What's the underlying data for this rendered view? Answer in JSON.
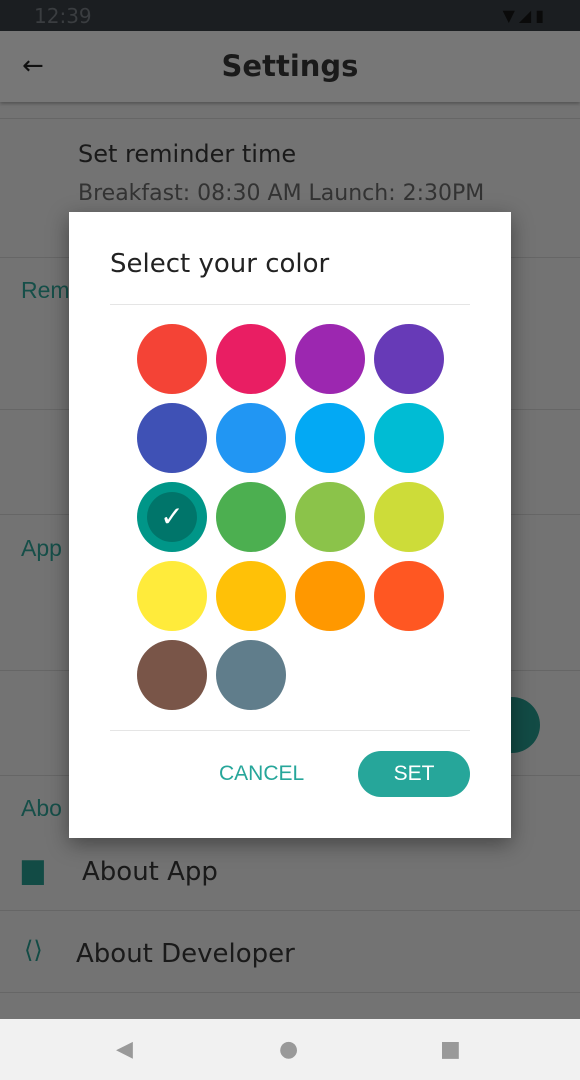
{
  "status_bar": {
    "time": "12:39",
    "icons": "wifi signal battery"
  },
  "app_bar": {
    "title": "Settings",
    "back_icon": "arrow-left-icon"
  },
  "settings": {
    "reminder_time": {
      "title": "Set reminder time",
      "subtitle": "Breakfast: 08:30 AM Launch: 2:30PM"
    },
    "sections": [
      "Rem",
      "App",
      "Abo"
    ],
    "about_app": "About App",
    "about_developer": "About Developer"
  },
  "dialog": {
    "title": "Select your color",
    "colors": [
      "#F44336",
      "#E91E63",
      "#9C27B0",
      "#673AB7",
      "#3F51B5",
      "#2196F3",
      "#03A9F4",
      "#00BCD4",
      "#009688",
      "#4CAF50",
      "#8BC34A",
      "#CDDC39",
      "#FFEB3B",
      "#FFC107",
      "#FF9800",
      "#FF5722",
      "#795548",
      "#607D8B"
    ],
    "selected_index": 8,
    "cancel_label": "CANCEL",
    "set_label": "SET"
  },
  "accent": "#26A69A"
}
